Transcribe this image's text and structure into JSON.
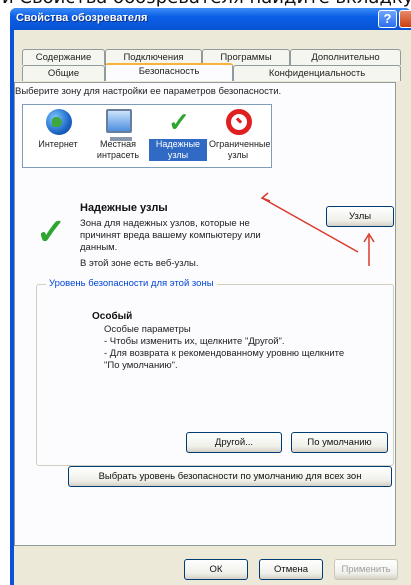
{
  "page_heading_fragment": "и Свойства обозревателя найдите вкладку Безопасность",
  "window": {
    "title": "Свойства обозревателя",
    "help_label": "?"
  },
  "tabs": [
    {
      "label": "Содержание"
    },
    {
      "label": "Подключения"
    },
    {
      "label": "Программы"
    },
    {
      "label": "Дополнительно"
    },
    {
      "label": "Общие"
    },
    {
      "label": "Безопасность"
    },
    {
      "label": "Конфиденциальность"
    }
  ],
  "zones": {
    "prompt": "Выберите зону для настройки ее параметров безопасности.",
    "items": [
      {
        "label": "Интернет",
        "icon": "globe-icon"
      },
      {
        "label": "Местная интрасеть",
        "icon": "computer-icon"
      },
      {
        "label": "Надежные узлы",
        "icon": "checkmark-icon"
      },
      {
        "label": "Ограниченные узлы",
        "icon": "no-entry-icon"
      }
    ]
  },
  "selected_zone": {
    "title": "Надежные узлы",
    "description": "Зона для надежных узлов, которые не причинят вреда вашему компьютеру или данным.",
    "note": "В этой зоне есть веб-узлы.",
    "sites_button": "Узлы"
  },
  "security_level": {
    "legend": "Уровень безопасности для этой зоны",
    "title": "Особый",
    "lines": [
      "Особые параметры",
      "- Чтобы изменить их, щелкните \"Другой\".",
      "- Для возврата к рекомендованному уровню щелкните",
      "\"По умолчанию\"."
    ],
    "custom_button": "Другой...",
    "default_button": "По умолчанию"
  },
  "reset_all_button": "Выбрать уровень безопасности по умолчанию для всех зон",
  "footer": {
    "ok": "ОК",
    "cancel": "Отмена",
    "apply": "Применить"
  },
  "colors": {
    "titlebar": "#0853d4",
    "selection": "#316ac5",
    "arrow": "#d93a2b",
    "legend": "#0046d5"
  }
}
